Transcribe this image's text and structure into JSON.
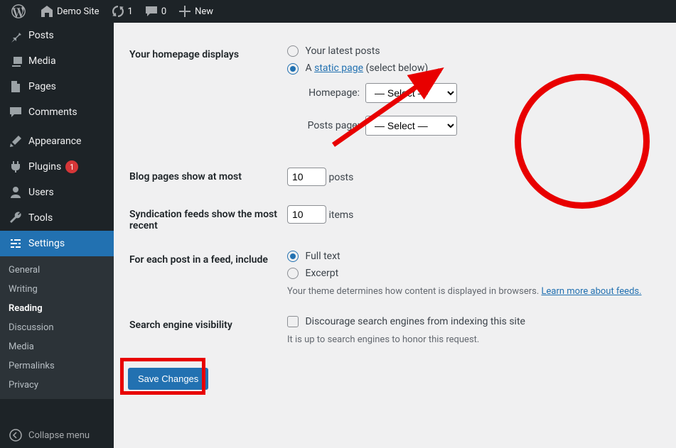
{
  "adminbar": {
    "site_title": "Demo Site",
    "updates_count": "1",
    "comments_count": "0",
    "new_label": "New"
  },
  "sidebar": {
    "items": [
      {
        "label": "Posts"
      },
      {
        "label": "Media"
      },
      {
        "label": "Pages"
      },
      {
        "label": "Comments"
      },
      {
        "label": "Appearance"
      },
      {
        "label": "Plugins",
        "badge": "1"
      },
      {
        "label": "Users"
      },
      {
        "label": "Tools"
      },
      {
        "label": "Settings"
      }
    ],
    "submenu": [
      {
        "label": "General"
      },
      {
        "label": "Writing"
      },
      {
        "label": "Reading"
      },
      {
        "label": "Discussion"
      },
      {
        "label": "Media"
      },
      {
        "label": "Permalinks"
      },
      {
        "label": "Privacy"
      }
    ],
    "collapse_label": "Collapse menu"
  },
  "settings": {
    "homepage_label": "Your homepage displays",
    "homepage_latest": "Your latest posts",
    "homepage_static_prefix": "A ",
    "homepage_static_link": "static page",
    "homepage_static_suffix": " (select below)",
    "homepage_select_label": "Homepage:",
    "postspage_select_label": "Posts page:",
    "select_placeholder": "— Select —",
    "blog_pages_label": "Blog pages show at most",
    "blog_pages_value": "10",
    "blog_pages_suffix": "posts",
    "syndication_label": "Syndication feeds show the most recent",
    "syndication_value": "10",
    "syndication_suffix": "items",
    "feed_content_label": "For each post in a feed, include",
    "feed_full": "Full text",
    "feed_excerpt": "Excerpt",
    "feed_desc": "Your theme determines how content is displayed in browsers. ",
    "feed_link": "Learn more about feeds.",
    "search_visibility_label": "Search engine visibility",
    "search_checkbox_label": "Discourage search engines from indexing this site",
    "search_desc": "It is up to search engines to honor this request.",
    "save_label": "Save Changes"
  }
}
